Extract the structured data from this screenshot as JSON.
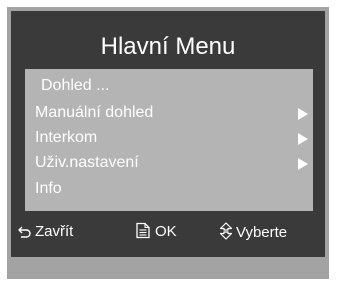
{
  "menu": {
    "title": "Hlavní Menu",
    "items": [
      {
        "label": "Dohled ...",
        "has_submenu": false
      },
      {
        "label": "Manuální dohled",
        "has_submenu": true
      },
      {
        "label": "Interkom",
        "has_submenu": true
      },
      {
        "label": "Uživ.nastavení",
        "has_submenu": true
      },
      {
        "label": "Info",
        "has_submenu": false
      }
    ]
  },
  "footer": {
    "close_label": "Zavřít",
    "ok_label": "OK",
    "select_label": "Vyberte"
  },
  "icons": {
    "close": "back-arrow-icon",
    "ok": "document-icon",
    "select": "up-down-arrows-icon"
  },
  "colors": {
    "frame": "#a3a3a3",
    "panel": "#3a3a3a",
    "menu_background": "#b4b4b4",
    "text": "#ffffff"
  }
}
